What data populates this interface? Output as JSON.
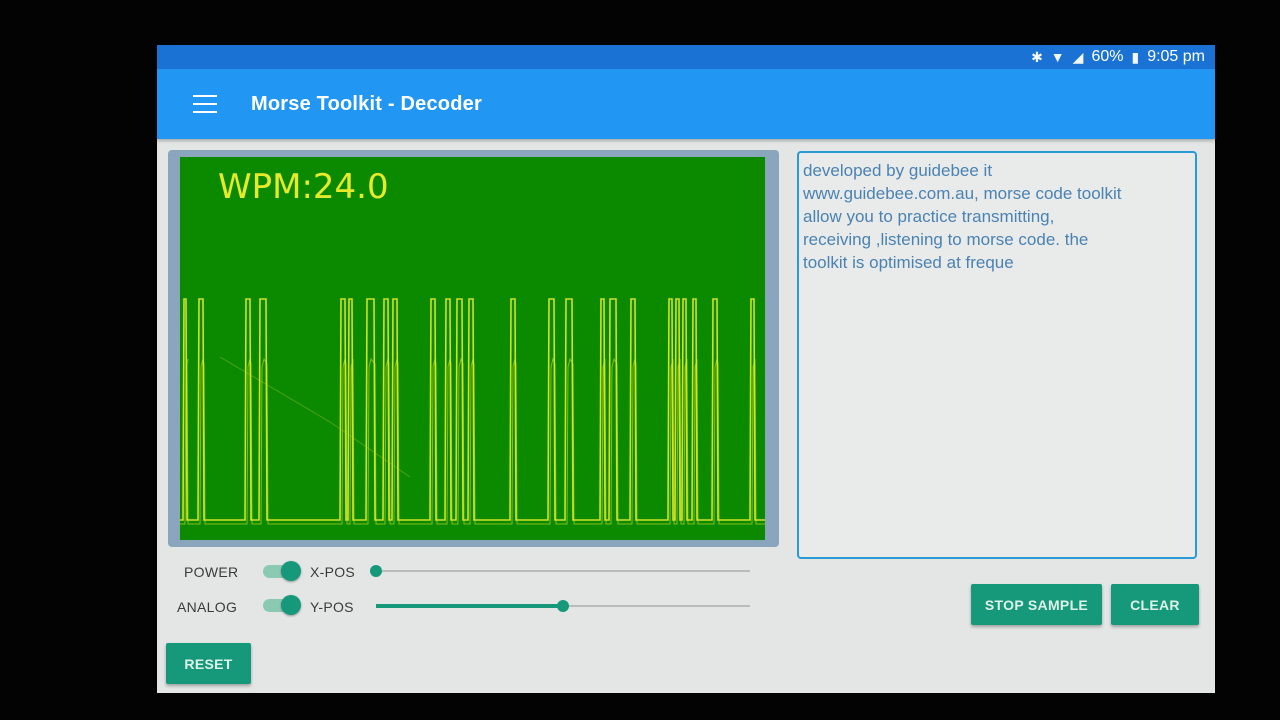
{
  "status_bar": {
    "battery": "60%",
    "time": "9:05 pm"
  },
  "app_bar": {
    "title": "Morse Toolkit - Decoder"
  },
  "scope": {
    "wpm_text": "WPM:24.0",
    "trace_color": "#e6ea2a",
    "background_color": "#0b8a00"
  },
  "decoded_text": "developed by guidebee it\nwww.guidebee.com.au, morse code toolkit\nallow you to practice transmitting,\nreceiving ,listening to morse code. the\ntoolkit is optimised at freque",
  "controls": {
    "power_label": "POWER",
    "analog_label": "ANALOG",
    "xpos_label": "X-POS",
    "ypos_label": "Y-POS",
    "power_on": true,
    "analog_on": true,
    "xpos_value": 0.0,
    "ypos_value": 0.5
  },
  "buttons": {
    "stop_sample": "STOP SAMPLE",
    "clear": "CLEAR",
    "reset": "RESET"
  },
  "colors": {
    "app_bar": "#2196f3",
    "status_bar": "#1a73d4",
    "accent": "#16987a",
    "text_border": "#2a9ad7"
  }
}
